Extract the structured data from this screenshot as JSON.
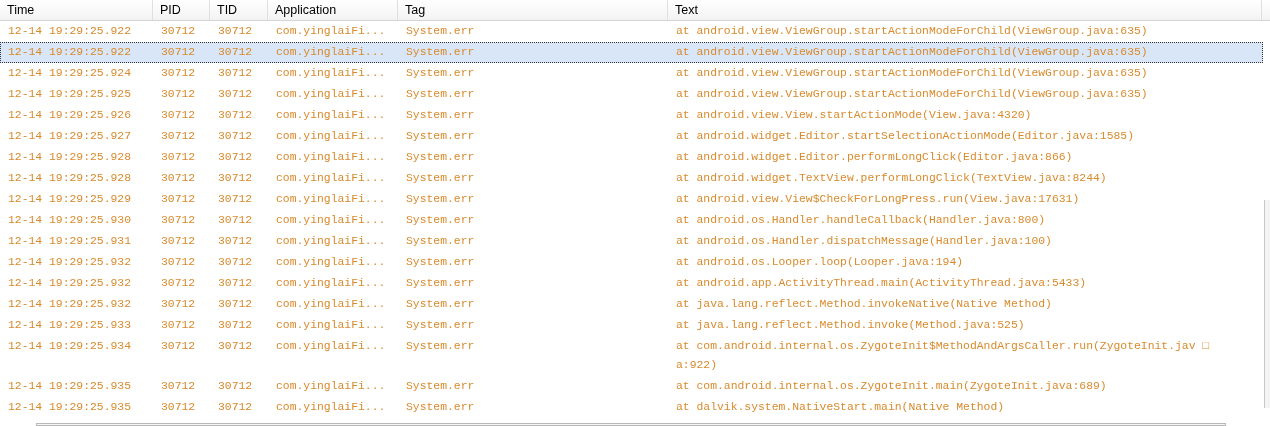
{
  "columns": [
    "Time",
    "PID",
    "TID",
    "Application",
    "Tag",
    "Text"
  ],
  "rows": [
    {
      "time": "12-14 19:29:25.922",
      "pid": "30712",
      "tid": "30712",
      "application": "com.yinglaiFi...",
      "tag": "System.err",
      "text": "at android.view.ViewGroup.startActionModeForChild(ViewGroup.java:635)",
      "selected": false
    },
    {
      "time": "12-14 19:29:25.922",
      "pid": "30712",
      "tid": "30712",
      "application": "com.yinglaiFi...",
      "tag": "System.err",
      "text": "at android.view.ViewGroup.startActionModeForChild(ViewGroup.java:635)",
      "selected": true
    },
    {
      "time": "12-14 19:29:25.924",
      "pid": "30712",
      "tid": "30712",
      "application": "com.yinglaiFi...",
      "tag": "System.err",
      "text": "at android.view.ViewGroup.startActionModeForChild(ViewGroup.java:635)",
      "selected": false
    },
    {
      "time": "12-14 19:29:25.925",
      "pid": "30712",
      "tid": "30712",
      "application": "com.yinglaiFi...",
      "tag": "System.err",
      "text": "at android.view.ViewGroup.startActionModeForChild(ViewGroup.java:635)",
      "selected": false
    },
    {
      "time": "12-14 19:29:25.926",
      "pid": "30712",
      "tid": "30712",
      "application": "com.yinglaiFi...",
      "tag": "System.err",
      "text": "at android.view.View.startActionMode(View.java:4320)",
      "selected": false
    },
    {
      "time": "12-14 19:29:25.927",
      "pid": "30712",
      "tid": "30712",
      "application": "com.yinglaiFi...",
      "tag": "System.err",
      "text": "at android.widget.Editor.startSelectionActionMode(Editor.java:1585)",
      "selected": false
    },
    {
      "time": "12-14 19:29:25.928",
      "pid": "30712",
      "tid": "30712",
      "application": "com.yinglaiFi...",
      "tag": "System.err",
      "text": "at android.widget.Editor.performLongClick(Editor.java:866)",
      "selected": false
    },
    {
      "time": "12-14 19:29:25.928",
      "pid": "30712",
      "tid": "30712",
      "application": "com.yinglaiFi...",
      "tag": "System.err",
      "text": "at android.widget.TextView.performLongClick(TextView.java:8244)",
      "selected": false
    },
    {
      "time": "12-14 19:29:25.929",
      "pid": "30712",
      "tid": "30712",
      "application": "com.yinglaiFi...",
      "tag": "System.err",
      "text": "at android.view.View$CheckForLongPress.run(View.java:17631)",
      "selected": false
    },
    {
      "time": "12-14 19:29:25.930",
      "pid": "30712",
      "tid": "30712",
      "application": "com.yinglaiFi...",
      "tag": "System.err",
      "text": "at android.os.Handler.handleCallback(Handler.java:800)",
      "selected": false
    },
    {
      "time": "12-14 19:29:25.931",
      "pid": "30712",
      "tid": "30712",
      "application": "com.yinglaiFi...",
      "tag": "System.err",
      "text": "at android.os.Handler.dispatchMessage(Handler.java:100)",
      "selected": false
    },
    {
      "time": "12-14 19:29:25.932",
      "pid": "30712",
      "tid": "30712",
      "application": "com.yinglaiFi...",
      "tag": "System.err",
      "text": "at android.os.Looper.loop(Looper.java:194)",
      "selected": false
    },
    {
      "time": "12-14 19:29:25.932",
      "pid": "30712",
      "tid": "30712",
      "application": "com.yinglaiFi...",
      "tag": "System.err",
      "text": "at android.app.ActivityThread.main(ActivityThread.java:5433)",
      "selected": false
    },
    {
      "time": "12-14 19:29:25.932",
      "pid": "30712",
      "tid": "30712",
      "application": "com.yinglaiFi...",
      "tag": "System.err",
      "text": "at java.lang.reflect.Method.invokeNative(Native Method)",
      "selected": false
    },
    {
      "time": "12-14 19:29:25.933",
      "pid": "30712",
      "tid": "30712",
      "application": "com.yinglaiFi...",
      "tag": "System.err",
      "text": "at java.lang.reflect.Method.invoke(Method.java:525)",
      "selected": false
    },
    {
      "time": "12-14 19:29:25.934",
      "pid": "30712",
      "tid": "30712",
      "application": "com.yinglaiFi...",
      "tag": "System.err",
      "text": "at com.android.internal.os.ZygoteInit$MethodAndArgsCaller.run(ZygoteInit.jav □\na:922)",
      "selected": false
    },
    {
      "time": "12-14 19:29:25.935",
      "pid": "30712",
      "tid": "30712",
      "application": "com.yinglaiFi...",
      "tag": "System.err",
      "text": "at com.android.internal.os.ZygoteInit.main(ZygoteInit.java:689)",
      "selected": false
    },
    {
      "time": "12-14 19:29:25.935",
      "pid": "30712",
      "tid": "30712",
      "application": "com.yinglaiFi...",
      "tag": "System.err",
      "text": "at dalvik.system.NativeStart.main(Native Method)",
      "selected": false
    }
  ]
}
